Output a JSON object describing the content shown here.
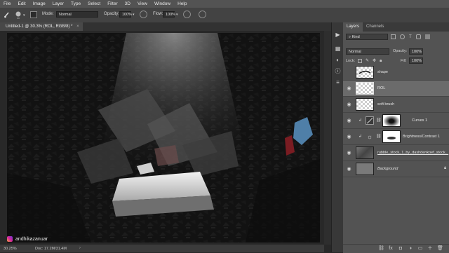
{
  "menu": [
    "File",
    "Edit",
    "Image",
    "Layer",
    "Type",
    "Select",
    "Filter",
    "3D",
    "View",
    "Window",
    "Help"
  ],
  "options": {
    "mode_label": "Mode:",
    "mode_value": "Normal",
    "opacity_label": "Opacity:",
    "opacity_value": "100%",
    "flow_label": "Flow:",
    "flow_value": "100%"
  },
  "document": {
    "tab_title": "Untitled-1 @ 30.3% (ROL, RGB/8) *"
  },
  "status": {
    "zoom": "30.25%",
    "doc_size": "Doc: 17.2M/31.4M"
  },
  "watermark": {
    "handle": "andhikazanuar"
  },
  "panel": {
    "tabs": [
      "Layers",
      "Channels"
    ],
    "kind_label": "Kind",
    "blend_mode": "Normal",
    "opacity_label": "Opacity:",
    "opacity_value": "100%",
    "lock_label": "Lock:",
    "fill_label": "Fill:",
    "fill_value": "100%"
  },
  "layers": [
    {
      "name": "shape",
      "visible": false
    },
    {
      "name": "ROL",
      "visible": true
    },
    {
      "name": "soft brush",
      "visible": true
    },
    {
      "name": "Curves 1",
      "visible": true
    },
    {
      "name": "Brightness/Contrast 1",
      "visible": true
    },
    {
      "name": "rubble_stock_1_by_dashdenkoef_stock...",
      "visible": true
    },
    {
      "name": "Background",
      "visible": true
    }
  ],
  "icons": {
    "brush_tool": "brush-icon",
    "eye": "eye-icon",
    "link": "link-icon",
    "instagram": "instagram-icon",
    "lock": "lock-icon"
  },
  "colors": {
    "menubar": "#535353",
    "panel": "#535353",
    "canvas_dark": "#121212",
    "light_beam": "#e8e8e8"
  }
}
